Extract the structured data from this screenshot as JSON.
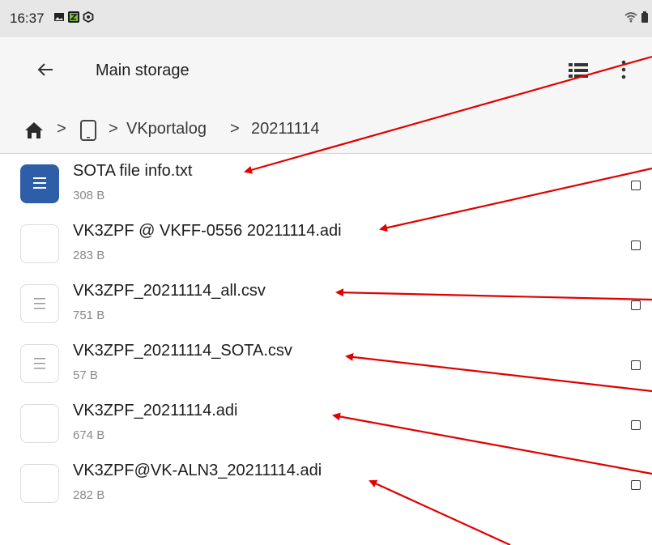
{
  "status_bar": {
    "time": "16:37",
    "icons": [
      "image-icon",
      "app-icon",
      "vpn-icon",
      "wifi-icon",
      "battery-icon"
    ]
  },
  "app_bar": {
    "title": "Main storage",
    "icons": [
      "back-arrow-icon",
      "list-view-icon",
      "more-vert-icon"
    ]
  },
  "breadcrumb": {
    "home_icon": "home-icon",
    "device_icon": "phone-icon",
    "separator": ">",
    "folder1": "VKportalog",
    "folder2": "20211114"
  },
  "files": [
    {
      "name": "SOTA file info.txt",
      "size": "308 B",
      "icon": "text-file-icon"
    },
    {
      "name": "VK3ZPF @ VKFF-0556 20211114.adi",
      "size": "283 B",
      "icon": "blank-file-icon"
    },
    {
      "name": "VK3ZPF_20211114_all.csv",
      "size": "751 B",
      "icon": "lines-file-icon"
    },
    {
      "name": "VK3ZPF_20211114_SOTA.csv",
      "size": "57 B",
      "icon": "lines-file-icon"
    },
    {
      "name": "VK3ZPF_20211114.adi",
      "size": "674 B",
      "icon": "blank-file-icon"
    },
    {
      "name": "VK3ZPF@VK-ALN3_20211114.adi",
      "size": "282 B",
      "icon": "blank-file-icon"
    }
  ],
  "colors": {
    "annotation_arrow": "#e00000",
    "accent_blue": "#2e5ea8",
    "status_bar_bg": "#e7e7e7",
    "app_bar_bg": "#f6f6f6"
  }
}
